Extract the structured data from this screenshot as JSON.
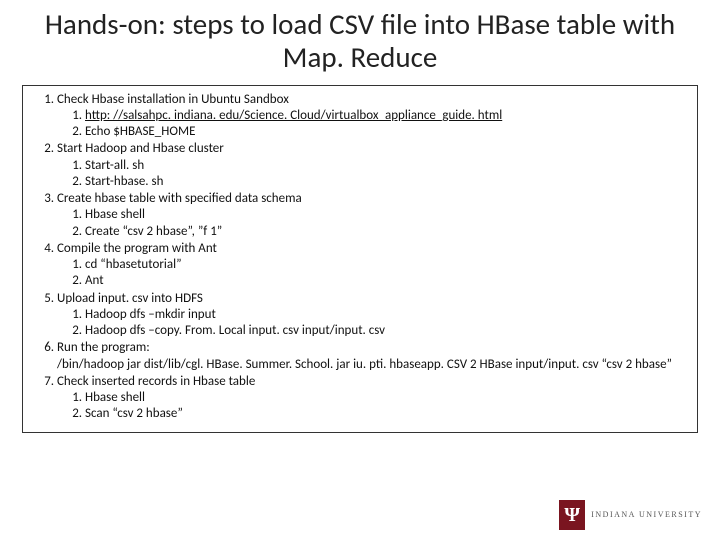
{
  "title": "Hands-on: steps to load CSV file into HBase table with Map. Reduce",
  "steps": {
    "s1": "Check Hbase installation in Ubuntu Sandbox",
    "s1_1": "http: //salsahpc. indiana. edu/Science. Cloud/virtualbox_appliance_guide. html",
    "s1_2": "Echo $HBASE_HOME",
    "s2": "Start Hadoop and Hbase cluster",
    "s2_1": "Start-all. sh",
    "s2_2": "Start-hbase. sh",
    "s3": "Create hbase table with specified data schema",
    "s3_1": "Hbase shell",
    "s3_2": "Create “csv 2 hbase”, ”f 1”",
    "s4": "Compile the program with Ant",
    "s4_1": "cd “hbasetutorial”",
    "s4_2": "Ant",
    "s5": "Upload input. csv into HDFS",
    "s5_1": "Hadoop dfs –mkdir input",
    "s5_2": "Hadoop dfs –copy. From. Local input. csv input/input. csv",
    "s6": "Run the program:",
    "s6_cont": "/bin/hadoop jar dist/lib/cgl. HBase. Summer. School. jar iu. pti. hbaseapp. CSV 2 HBase input/input. csv “csv 2 hbase”",
    "s7": "Check inserted records in Hbase table",
    "s7_1": "Hbase shell",
    "s7_2": "Scan “csv 2 hbase”"
  },
  "logo_text": "INDIANA UNIVERSITY"
}
